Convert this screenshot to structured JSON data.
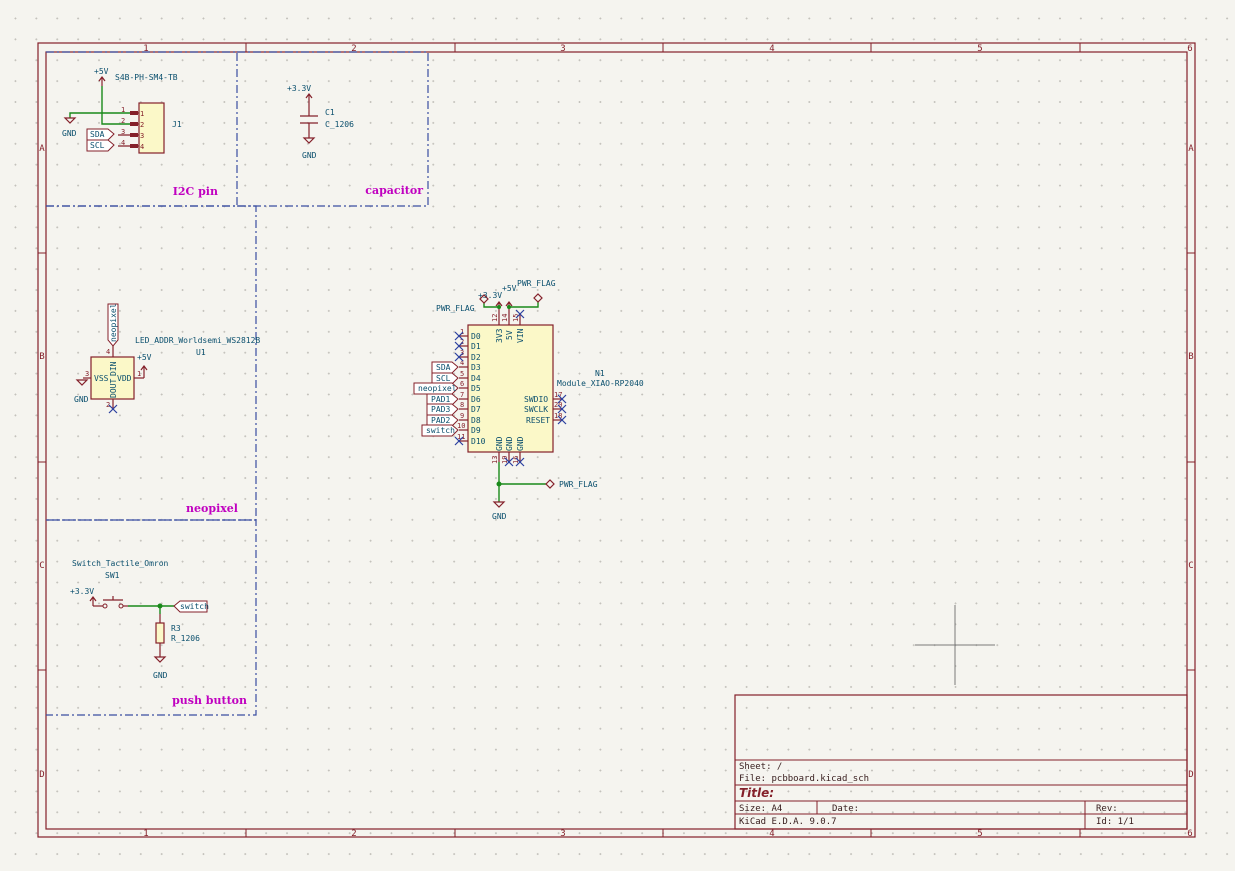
{
  "sheet": {
    "columns": [
      "1",
      "2",
      "3",
      "4",
      "5",
      "6"
    ],
    "rows": [
      "A",
      "B",
      "C",
      "D"
    ]
  },
  "notes": {
    "i2c": "I2C pin",
    "capacitor": "capacitor",
    "neopixel": "neopixel",
    "push_button": "push button"
  },
  "j1": {
    "ref": "J1",
    "value": "S4B-PH-SM4-TB",
    "pins": [
      "1",
      "2",
      "3",
      "4"
    ],
    "pads": [
      "1",
      "2",
      "3",
      "4"
    ],
    "power": "+5V",
    "gnd": "GND",
    "labels": [
      "SDA",
      "SCL"
    ]
  },
  "c1": {
    "ref": "C1",
    "value": "C_1206",
    "power": "+3.3V",
    "gnd": "GND"
  },
  "u1": {
    "ref": "U1",
    "value": "LED_ADDR_Worldsemi_WS2812B",
    "label": "neopixel",
    "pins": {
      "din": "DIN",
      "dout": "DOUT",
      "vss": "VSS",
      "vdd": "VDD"
    },
    "pin_nums": {
      "p4": "4",
      "p3": "3",
      "p1": "1",
      "p2": "2"
    },
    "power": "+5V",
    "gnd": "GND"
  },
  "sw1": {
    "ref": "SW1",
    "value": "Switch_Tactile_Omron",
    "power": "+3.3V",
    "label": "switch"
  },
  "r3": {
    "ref": "R3",
    "value": "R_1206",
    "gnd": "GND"
  },
  "n1": {
    "ref": "N1",
    "value": "Module_XIAO-RP2040",
    "left_pins": [
      "D0",
      "D1",
      "D2",
      "D3",
      "D4",
      "D5",
      "D6",
      "D7",
      "D8",
      "D9",
      "D10"
    ],
    "left_nums": [
      "1",
      "2",
      "3",
      "4",
      "5",
      "6",
      "7",
      "8",
      "9",
      "10",
      "11"
    ],
    "top_pins": [
      "3V3",
      "5V",
      "VIN"
    ],
    "top_nums": [
      "12",
      "14",
      "15"
    ],
    "right_pins": [
      "SWDIO",
      "SWCLK",
      "RESET"
    ],
    "right_nums": [
      "17",
      "20",
      "18"
    ],
    "bottom_pins": [
      "GND",
      "GND",
      "GND"
    ],
    "bottom_nums": [
      "13",
      "19",
      "16"
    ],
    "labels": [
      "SDA",
      "SCL",
      "neopixel",
      "PAD1",
      "PAD3",
      "PAD2",
      "switch"
    ],
    "pwr_flag": "PWR_FLAG",
    "power_33": "+3.3V",
    "power_5": "+5V",
    "gnd": "GND"
  },
  "title_block": {
    "sheet": "Sheet: /",
    "file": "File: pcbboard.kicad_sch",
    "title": "Title:",
    "size": "Size: A4",
    "date": "Date:",
    "rev": "Rev:",
    "tool": "KiCad E.D.A. 9.0.7",
    "id": "Id: 1/1"
  }
}
